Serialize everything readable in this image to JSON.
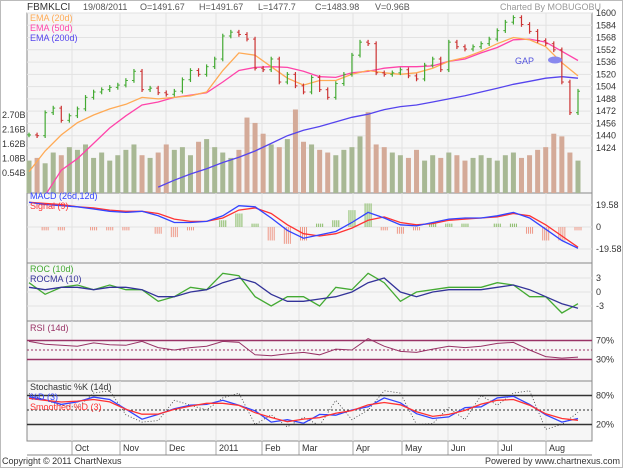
{
  "header": {
    "symbol": "FBMKLCI",
    "date": "19/08/2011",
    "open": "O=1491.67",
    "high": "H=1491.67",
    "low": "L=1477.7",
    "close": "C=1483.98",
    "volume": "V=0.96B",
    "credit": "Charted By MOBUGOBU"
  },
  "footer": {
    "copyright": "Copyright © 2011 ChartNexus",
    "powered": "Powered by www.chartnexus.com"
  },
  "colors": {
    "up": "#44aa33",
    "down": "#cc3333",
    "ema20": "#ffaa55",
    "ema50": "#ff44aa",
    "ema200": "#5544ee",
    "macd": "#3344ff",
    "signal": "#ff3333",
    "roc": "#44aa33",
    "rocma": "#333399",
    "rsi": "#993366",
    "k": "#333333",
    "d": "#3344ff",
    "sd": "#ff3333"
  },
  "chart_data": [
    {
      "type": "line",
      "title": "FBMKLCI price (OHLC) with EMA",
      "legend": [
        "EMA (20d)",
        "EMA (50d)",
        "EMA (200d)"
      ],
      "annotation": "GAP",
      "y_ticks": [
        "1600",
        "1584",
        "1568",
        "1552",
        "1536",
        "1520",
        "1504",
        "1488",
        "1472",
        "1456",
        "1440",
        "1424"
      ],
      "ylim": [
        1360,
        1600
      ],
      "close": [
        1441,
        1440,
        1470,
        1476,
        1460,
        1466,
        1475,
        1490,
        1497,
        1500,
        1503,
        1506,
        1512,
        1524,
        1500,
        1502,
        1496,
        1494,
        1498,
        1513,
        1525,
        1520,
        1530,
        1540,
        1570,
        1575,
        1572,
        1566,
        1528,
        1526,
        1540,
        1510,
        1520,
        1505,
        1497,
        1516,
        1500,
        1490,
        1508,
        1520,
        1545,
        1562,
        1560,
        1522,
        1520,
        1522,
        1526,
        1518,
        1514,
        1532,
        1540,
        1526,
        1562,
        1556,
        1553,
        1556,
        1560,
        1566,
        1577,
        1588,
        1594,
        1585,
        1576,
        1564,
        1560,
        1552,
        1510,
        1470,
        1498
      ],
      "ema20": [
        1393,
        1420,
        1441,
        1457,
        1467,
        1475,
        1481,
        1490,
        1488,
        1490,
        1492,
        1497,
        1525,
        1548,
        1545,
        1530,
        1515,
        1506,
        1512,
        1512,
        1520,
        1525,
        1522,
        1520,
        1522,
        1528,
        1537,
        1542,
        1550,
        1560,
        1568,
        1565,
        1556,
        1535,
        1518
      ],
      "ema50": [
        null,
        1362,
        1395,
        1410,
        1430,
        1450,
        1466,
        1480,
        1484,
        1490,
        1493,
        1496,
        1510,
        1525,
        1529,
        1530,
        1529,
        1524,
        1517,
        1516,
        1522,
        1524,
        1528,
        1530,
        1530,
        1531,
        1537,
        1540,
        1548,
        1555,
        1565,
        1566,
        1562,
        1550,
        1538
      ],
      "ema200": [
        null,
        null,
        null,
        null,
        null,
        null,
        null,
        null,
        1373,
        1382,
        1390,
        1397,
        1405,
        1412,
        1420,
        1430,
        1440,
        1447,
        1452,
        1458,
        1464,
        1468,
        1474,
        1478,
        1480,
        1484,
        1488,
        1492,
        1497,
        1502,
        1507,
        1511,
        1515,
        1517,
        1515
      ]
    },
    {
      "type": "bar",
      "title": "Volume",
      "y_ticks": [
        "2.70B",
        "2.16B",
        "1.62B",
        "1.08B",
        "0.54B"
      ],
      "values": [
        1.0,
        1.1,
        0.9,
        1.3,
        1.2,
        1.5,
        1.4,
        1.6,
        1.1,
        1.3,
        1.0,
        1.2,
        1.4,
        1.6,
        1.2,
        1.1,
        1.3,
        1.6,
        1.4,
        1.5,
        1.2,
        1.7,
        1.8,
        1.5,
        1.3,
        1.1,
        1.4,
        2.6,
        2.4,
        2.0,
        1.6,
        1.5,
        1.8,
        2.9,
        1.7,
        1.6,
        1.4,
        1.3,
        1.2,
        1.4,
        1.5,
        1.9,
        2.8,
        1.6,
        1.5,
        1.3,
        1.2,
        1.1,
        1.4,
        1.0,
        1.2,
        1.1,
        1.3,
        1.2,
        1.0,
        1.1,
        1.2,
        1.1,
        1.0,
        1.2,
        1.3,
        1.1,
        1.2,
        1.4,
        1.5,
        2.0,
        1.9,
        1.3,
        1.0
      ]
    },
    {
      "type": "line",
      "title": "MACD (26d,12d)",
      "legend": [
        "MACD (26d,12d)",
        "Signal (9)"
      ],
      "y_ticks": [
        "19.58",
        "0",
        "-19.58"
      ],
      "ylim": [
        -29,
        29
      ],
      "macd": [
        22,
        20,
        19,
        18,
        16,
        14,
        13,
        14,
        10,
        4,
        4,
        5,
        10,
        19,
        18,
        8,
        -3,
        -10,
        -7,
        -4,
        4,
        13,
        8,
        2,
        1,
        4,
        7,
        8,
        8,
        10,
        13,
        8,
        -2,
        -12,
        -19
      ],
      "signal": [
        22,
        21,
        20,
        18,
        17,
        15,
        14,
        14,
        12,
        7,
        5,
        5,
        8,
        15,
        17,
        12,
        2,
        -6,
        -8,
        -6,
        -1,
        6,
        9,
        4,
        2,
        3,
        6,
        7,
        8,
        9,
        12,
        10,
        2,
        -8,
        -18
      ]
    },
    {
      "type": "line",
      "title": "ROC (10d)",
      "legend": [
        "ROC (10d)",
        "ROCMA (10)"
      ],
      "y_ticks": [
        "3",
        "0",
        "-3"
      ],
      "ylim": [
        -6,
        6
      ],
      "roc": [
        2,
        -0.5,
        1,
        1.5,
        0.5,
        1.5,
        0.5,
        0.5,
        -2,
        -1,
        1,
        0.5,
        4,
        3.5,
        -1,
        -3,
        -1,
        -1,
        -3,
        1,
        0.5,
        4,
        2,
        -2,
        0,
        0.5,
        1,
        1,
        1,
        2,
        1.5,
        -1,
        -1,
        -4.5,
        -2.5
      ],
      "rocma": [
        1,
        0.5,
        1,
        1,
        0.5,
        1,
        1,
        0.5,
        -1,
        -1,
        0,
        0.5,
        2,
        3,
        2,
        -0.5,
        -2,
        -2,
        -1.5,
        -1,
        0,
        2,
        3,
        0,
        -1,
        0,
        0.5,
        0.5,
        0.5,
        1,
        1.5,
        0.5,
        -1,
        -2.5,
        -3.5
      ]
    },
    {
      "type": "line",
      "title": "RSI (14d)",
      "y_ticks": [
        "70%",
        "30%"
      ],
      "ylim": [
        0,
        100
      ],
      "rsi": [
        68,
        62,
        60,
        58,
        65,
        61,
        60,
        68,
        55,
        50,
        55,
        58,
        68,
        66,
        40,
        38,
        42,
        45,
        40,
        52,
        50,
        74,
        58,
        47,
        45,
        52,
        58,
        55,
        58,
        64,
        66,
        50,
        36,
        33,
        35
      ]
    },
    {
      "type": "line",
      "title": "Stochastic %K (14d)",
      "legend": [
        "Stochastic %K (14d)",
        "%D (3)",
        "Smoothed %D (3)"
      ],
      "y_ticks": [
        "80%",
        "20%"
      ],
      "ylim": [
        -15,
        115
      ],
      "k": [
        84,
        70,
        60,
        55,
        85,
        90,
        40,
        25,
        28,
        70,
        60,
        50,
        75,
        85,
        20,
        40,
        15,
        35,
        18,
        70,
        30,
        50,
        90,
        85,
        20,
        22,
        55,
        30,
        80,
        60,
        85,
        90,
        10,
        20,
        45
      ]
    },
    {
      "type": "axis",
      "x_ticks": [
        "Oct",
        "Nov",
        "Dec",
        "2011",
        "Feb",
        "Mar",
        "Apr",
        "May",
        "Jun",
        "Jul",
        "Aug"
      ]
    }
  ]
}
